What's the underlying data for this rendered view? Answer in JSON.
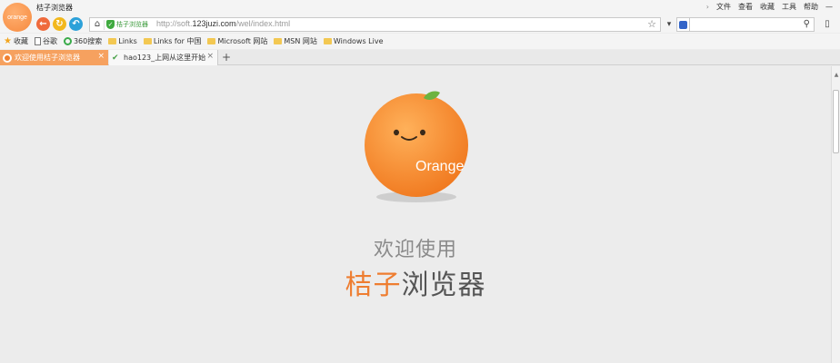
{
  "window": {
    "title": "桔子浏览器",
    "logo_text": "orange"
  },
  "menu": {
    "items": [
      "文件",
      "查看",
      "收藏",
      "工具",
      "帮助"
    ],
    "minimize": "—"
  },
  "address_bar": {
    "trust_label": "桔子浏览器",
    "url_prefix": "http://soft.",
    "url_domain": "123juzi.com",
    "url_suffix": "/wel/index.html"
  },
  "search": {
    "value": "",
    "engine_color": "#3264c8"
  },
  "bookmarks": [
    {
      "label": "收藏",
      "icon": "star-icon"
    },
    {
      "label": "谷歌",
      "icon": "page-icon"
    },
    {
      "label": "360搜索",
      "icon": "360-icon"
    },
    {
      "label": "Links",
      "icon": "folder-icon"
    },
    {
      "label": "Links for 中国",
      "icon": "folder-icon"
    },
    {
      "label": "Microsoft 网站",
      "icon": "folder-icon"
    },
    {
      "label": "MSN 网站",
      "icon": "folder-icon"
    },
    {
      "label": "Windows Live",
      "icon": "folder-icon"
    }
  ],
  "tabs": [
    {
      "label": "欢迎使用桔子浏览器",
      "active": true
    },
    {
      "label": "hao123_上网从这里开始",
      "active": false
    }
  ],
  "welcome": {
    "logo_text": "Orange",
    "line1": "欢迎使用",
    "line2_accent": "桔子",
    "line2_rest": "浏览器"
  },
  "colors": {
    "accent": "#ee7d30",
    "active_tab": "#f6a15f"
  }
}
